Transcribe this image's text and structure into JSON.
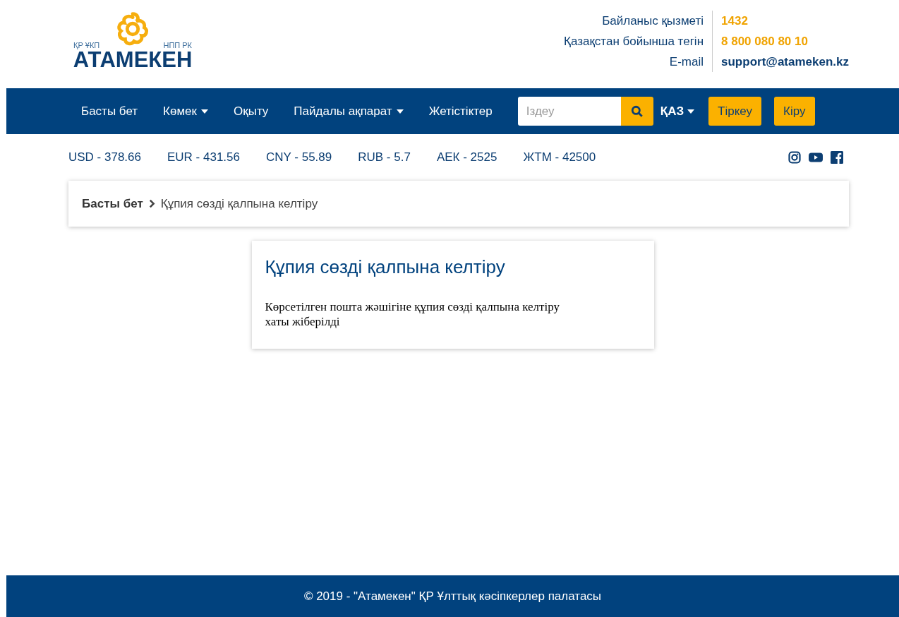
{
  "logo": {
    "left_caption": "ҚР ҰКП",
    "right_caption": "НПП РК",
    "wordmark": "АТАМЕКЕН"
  },
  "contacts": [
    {
      "label": "Байланыс қызметі",
      "value": "1432",
      "kind": "phone"
    },
    {
      "label": "Қазақстан бойынша тегін",
      "value": "8 800 080 80 10",
      "kind": "phone"
    },
    {
      "label": "E-mail",
      "value": "support@atameken.kz",
      "kind": "email"
    }
  ],
  "nav": {
    "items": [
      {
        "label": "Басты бет",
        "dropdown": false
      },
      {
        "label": "Көмек",
        "dropdown": true
      },
      {
        "label": "Оқыту",
        "dropdown": false
      },
      {
        "label": "Пайдалы ақпарат",
        "dropdown": true
      },
      {
        "label": "Жетістіктер",
        "dropdown": false
      }
    ],
    "search": {
      "placeholder": "Іздеу"
    },
    "language": "ҚАЗ",
    "buttons": [
      "Тіркеу",
      "Кіру"
    ]
  },
  "rates": [
    "USD - 378.66",
    "EUR - 431.56",
    "CNY - 55.89",
    "RUB - 5.7",
    "АЕК - 2525",
    "ЖТМ - 42500"
  ],
  "social": [
    {
      "kind": "instagram"
    },
    {
      "kind": "youtube"
    },
    {
      "kind": "facebook"
    }
  ],
  "breadcrumb": [
    "Басты бет",
    "Құпия сөзді қалпына келтіру"
  ],
  "card": {
    "title": "Құпия сөзді қалпына келтіру",
    "message": "Көрсетілген пошта жәшігіне құпия сөзді қалпына келтіру хаты жіберілді"
  },
  "footer": "© 2019 - \"Атамекен\" ҚР Ұлттық кәсіпкерлер палатасы"
}
